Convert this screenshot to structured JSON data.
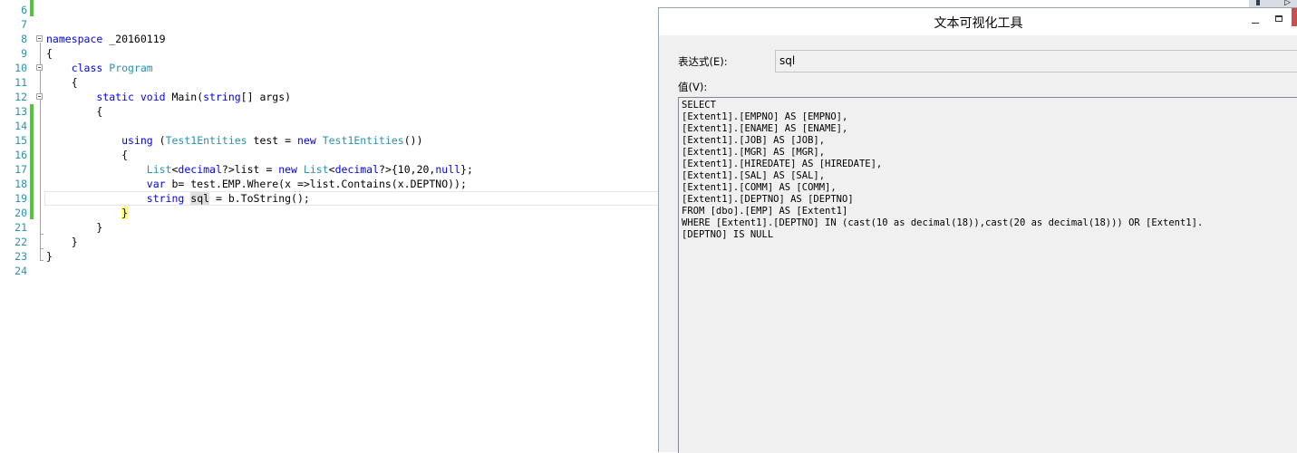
{
  "editor": {
    "lines": [
      {
        "num": "6",
        "parts": []
      },
      {
        "num": "7",
        "parts": []
      },
      {
        "num": "8",
        "parts": [
          {
            "t": "namespace",
            "c": "kw"
          },
          {
            "t": " _20160119",
            "c": ""
          }
        ]
      },
      {
        "num": "9",
        "parts": [
          {
            "t": "{",
            "c": ""
          }
        ]
      },
      {
        "num": "10",
        "parts": [
          {
            "t": "    ",
            "c": ""
          },
          {
            "t": "class",
            "c": "kw"
          },
          {
            "t": " ",
            "c": ""
          },
          {
            "t": "Program",
            "c": "ty"
          }
        ]
      },
      {
        "num": "11",
        "parts": [
          {
            "t": "    {",
            "c": ""
          }
        ]
      },
      {
        "num": "12",
        "parts": [
          {
            "t": "        ",
            "c": ""
          },
          {
            "t": "static",
            "c": "kw"
          },
          {
            "t": " ",
            "c": ""
          },
          {
            "t": "void",
            "c": "kw"
          },
          {
            "t": " Main(",
            "c": ""
          },
          {
            "t": "string",
            "c": "kw"
          },
          {
            "t": "[] args)",
            "c": ""
          }
        ]
      },
      {
        "num": "13",
        "parts": [
          {
            "t": "        {",
            "c": ""
          }
        ]
      },
      {
        "num": "14",
        "parts": []
      },
      {
        "num": "15",
        "parts": [
          {
            "t": "            ",
            "c": ""
          },
          {
            "t": "using",
            "c": "kw"
          },
          {
            "t": " (",
            "c": ""
          },
          {
            "t": "Test1Entities",
            "c": "ty"
          },
          {
            "t": " test = ",
            "c": ""
          },
          {
            "t": "new",
            "c": "kw"
          },
          {
            "t": " ",
            "c": ""
          },
          {
            "t": "Test1Entities",
            "c": "ty"
          },
          {
            "t": "())",
            "c": ""
          }
        ]
      },
      {
        "num": "16",
        "parts": [
          {
            "t": "            {",
            "c": ""
          }
        ]
      },
      {
        "num": "17",
        "parts": [
          {
            "t": "                ",
            "c": ""
          },
          {
            "t": "List",
            "c": "ty"
          },
          {
            "t": "<",
            "c": ""
          },
          {
            "t": "decimal",
            "c": "kw"
          },
          {
            "t": "?>list = ",
            "c": ""
          },
          {
            "t": "new",
            "c": "kw"
          },
          {
            "t": " ",
            "c": ""
          },
          {
            "t": "List",
            "c": "ty"
          },
          {
            "t": "<",
            "c": ""
          },
          {
            "t": "decimal",
            "c": "kw"
          },
          {
            "t": "?>{10,20,",
            "c": ""
          },
          {
            "t": "null",
            "c": "kw"
          },
          {
            "t": "};",
            "c": ""
          }
        ]
      },
      {
        "num": "18",
        "parts": [
          {
            "t": "                ",
            "c": ""
          },
          {
            "t": "var",
            "c": "kw"
          },
          {
            "t": " b= test.EMP.Where(x =>list.Contains(x.DEPTNO));",
            "c": ""
          }
        ]
      },
      {
        "num": "19",
        "parts": [
          {
            "t": "                ",
            "c": ""
          },
          {
            "t": "string",
            "c": "kw"
          },
          {
            "t": " ",
            "c": ""
          },
          {
            "t": "sql",
            "c": "hl-word"
          },
          {
            "t": " = b.ToString();",
            "c": ""
          }
        ]
      },
      {
        "num": "20",
        "parts": [
          {
            "t": "            ",
            "c": ""
          },
          {
            "t": "}",
            "c": "brace-hl"
          }
        ]
      },
      {
        "num": "21",
        "parts": [
          {
            "t": "        }",
            "c": ""
          }
        ]
      },
      {
        "num": "22",
        "parts": [
          {
            "t": "    }",
            "c": ""
          }
        ]
      },
      {
        "num": "23",
        "parts": [
          {
            "t": "}",
            "c": ""
          }
        ]
      },
      {
        "num": "24",
        "parts": []
      }
    ]
  },
  "dialog": {
    "title": "文本可视化工具",
    "expression_label": "表达式(E):",
    "expression_value": "sql",
    "value_label": "值(V):",
    "value_text": "SELECT\n[Extent1].[EMPNO] AS [EMPNO],\n[Extent1].[ENAME] AS [ENAME],\n[Extent1].[JOB] AS [JOB],\n[Extent1].[MGR] AS [MGR],\n[Extent1].[HIREDATE] AS [HIREDATE],\n[Extent1].[SAL] AS [SAL],\n[Extent1].[COMM] AS [COMM],\n[Extent1].[DEPTNO] AS [DEPTNO]\nFROM [dbo].[EMP] AS [Extent1]\nWHERE [Extent1].[DEPTNO] IN (cast(10 as decimal(18)),cast(20 as decimal(18))) OR [Extent1].\n[DEPTNO] IS NULL"
  },
  "corner": {
    "glyph": "▷"
  },
  "colors": {
    "keyword": "#0000ff",
    "type": "#2b91af",
    "line_number": "#2b91af",
    "change_bar": "#57c43d",
    "brace_highlight": "#fffa80"
  }
}
